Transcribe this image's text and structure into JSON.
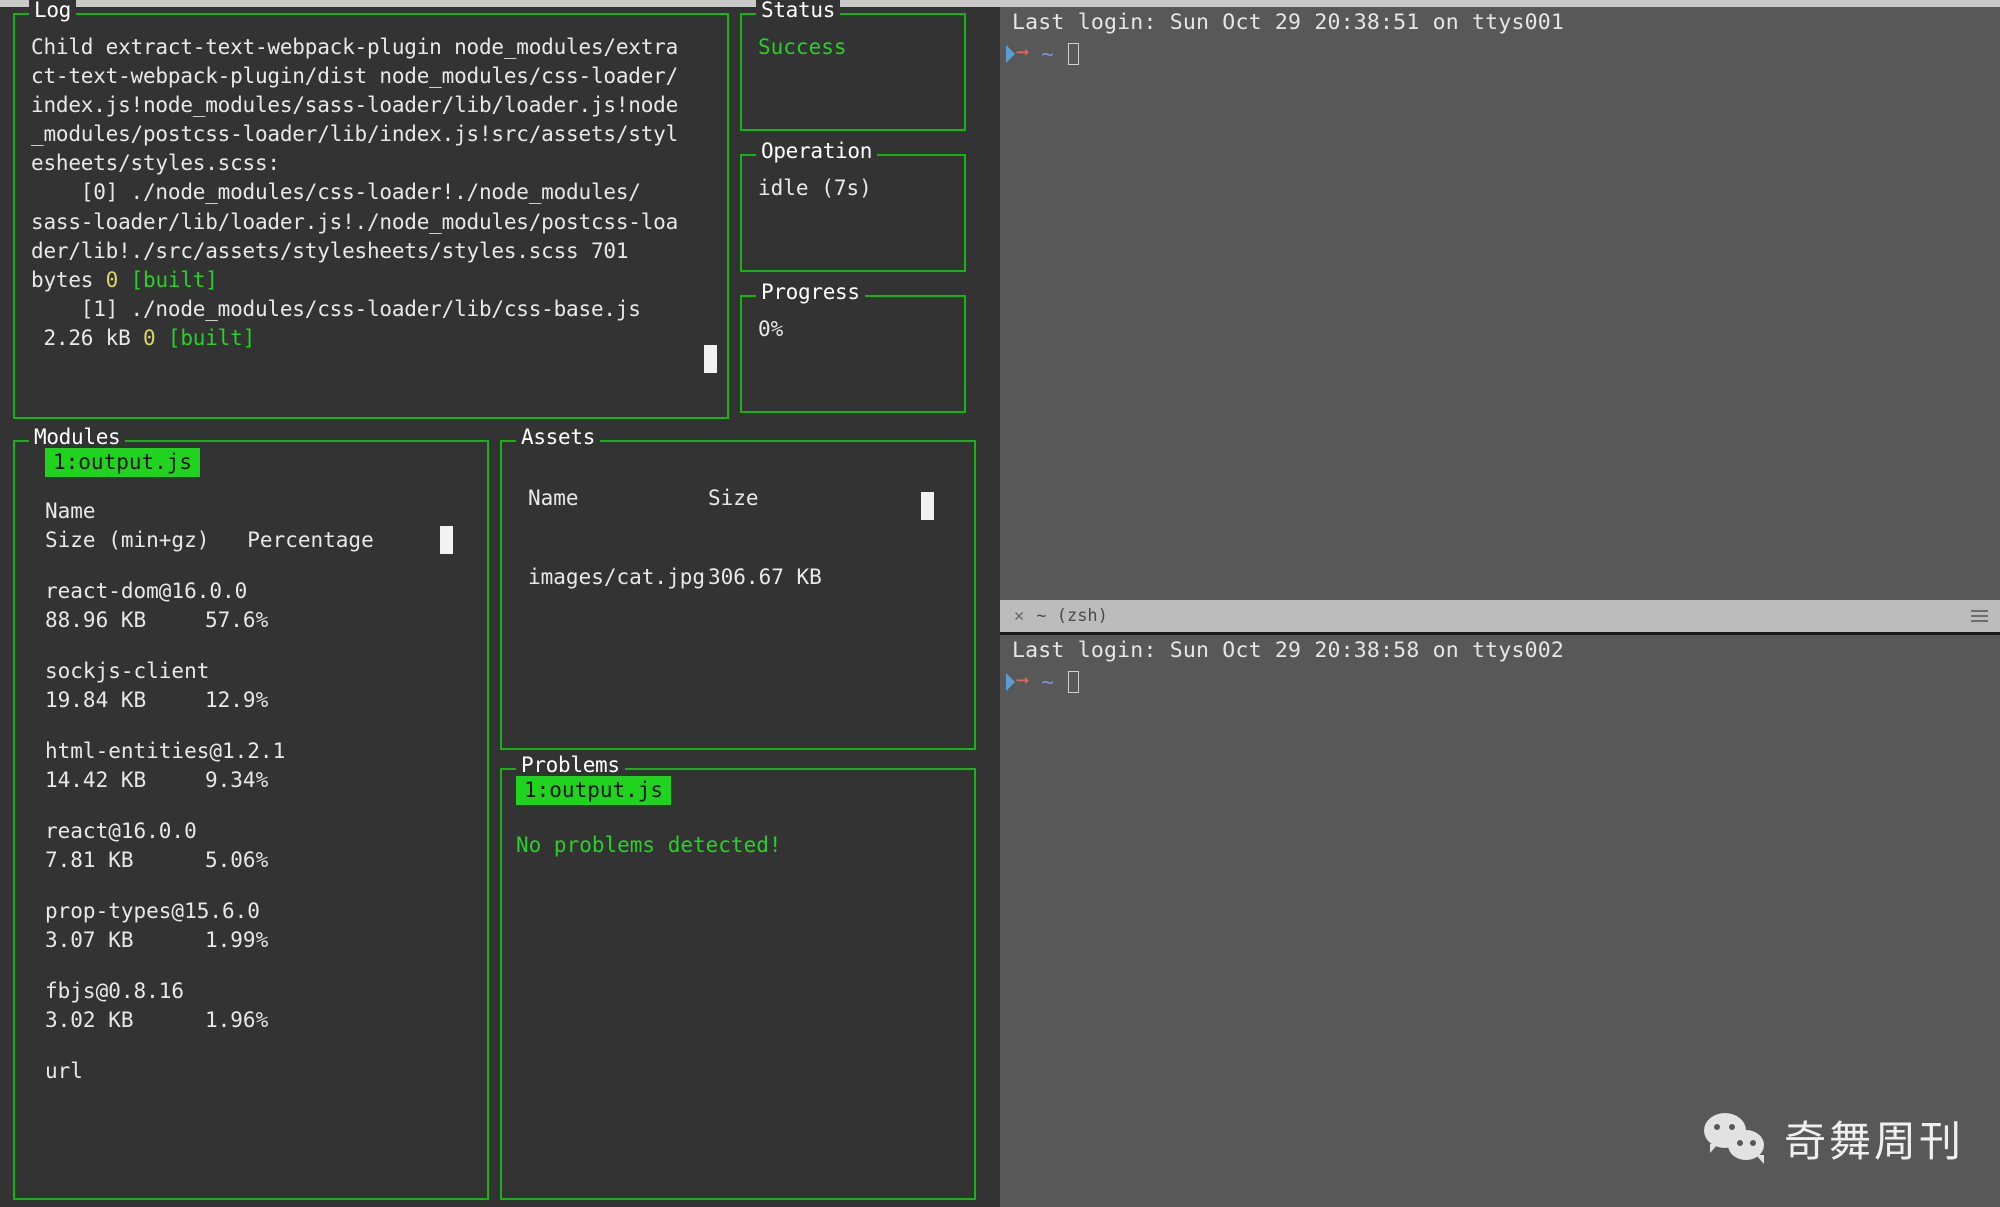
{
  "dashboard": {
    "log": {
      "title": "Log",
      "lines": [
        [
          {
            "t": "Child extract-text-webpack-plugin node_modules/extra",
            "c": "plain"
          }
        ],
        [
          {
            "t": "ct-text-webpack-plugin/dist node_modules/css-loader/",
            "c": "plain"
          }
        ],
        [
          {
            "t": "index.js!node_modules/sass-loader/lib/loader.js!node",
            "c": "plain"
          }
        ],
        [
          {
            "t": "_modules/postcss-loader/lib/index.js!src/assets/styl",
            "c": "plain"
          }
        ],
        [
          {
            "t": "esheets/styles.scss:",
            "c": "plain"
          }
        ],
        [
          {
            "t": "    [0] ./node_modules/css-loader!./node_modules/",
            "c": "plain"
          }
        ],
        [
          {
            "t": "sass-loader/lib/loader.js!./node_modules/postcss-loa",
            "c": "plain"
          }
        ],
        [
          {
            "t": "der/lib!./src/assets/stylesheets/styles.scss 701",
            "c": "plain"
          }
        ],
        [
          {
            "t": "bytes ",
            "c": "plain"
          },
          {
            "t": "0",
            "c": "yellow"
          },
          {
            "t": " ",
            "c": "plain"
          },
          {
            "t": "[built]",
            "c": "green"
          }
        ],
        [
          {
            "t": "    [1] ./node_modules/css-loader/lib/css-base.js",
            "c": "plain"
          }
        ],
        [
          {
            "t": " 2.26 kB ",
            "c": "plain"
          },
          {
            "t": "0",
            "c": "yellow"
          },
          {
            "t": " ",
            "c": "plain"
          },
          {
            "t": "[built]",
            "c": "green"
          }
        ]
      ]
    },
    "status": {
      "title": "Status",
      "value": "Success"
    },
    "operation": {
      "title": "Operation",
      "value": "idle (7s)"
    },
    "progress": {
      "title": "Progress",
      "value": "0%"
    },
    "modules": {
      "title": "Modules",
      "tab": "1:output.js",
      "header_name": "Name",
      "header_cols": "Size (min+gz)   Percentage",
      "rows": [
        {
          "name": "react-dom@16.0.0",
          "size": "88.96 KB",
          "percentage": "57.6%"
        },
        {
          "name": "sockjs-client",
          "size": "19.84 KB",
          "percentage": "12.9%"
        },
        {
          "name": "html-entities@1.2.1",
          "size": "14.42 KB",
          "percentage": "9.34%"
        },
        {
          "name": "react@16.0.0",
          "size": "7.81 KB",
          "percentage": "5.06%"
        },
        {
          "name": "prop-types@15.6.0",
          "size": "3.07 KB",
          "percentage": "1.99%"
        },
        {
          "name": "fbjs@0.8.16",
          "size": "3.02 KB",
          "percentage": "1.96%"
        },
        {
          "name": "url",
          "size": "",
          "percentage": ""
        }
      ]
    },
    "assets": {
      "title": "Assets",
      "header_name": "Name",
      "header_size": "Size",
      "rows": [
        {
          "name": "images/cat.jpg",
          "size": "306.67 KB"
        }
      ]
    },
    "problems": {
      "title": "Problems",
      "tab": "1:output.js",
      "message": "No problems detected!"
    }
  },
  "terminal": {
    "pane1": {
      "last_login": "Last login: Sun Oct 29 20:38:51 on ttys001",
      "prompt_path": "~"
    },
    "divider": {
      "close_glyph": "✕",
      "title": "~ (zsh)"
    },
    "pane2": {
      "last_login": "Last login: Sun Oct 29 20:38:58 on ttys002",
      "prompt_path": "~"
    }
  },
  "watermark": {
    "text": "奇舞周刊"
  },
  "colors": {
    "border_green": "#12b512",
    "accent_green": "#27d127",
    "chip_green": "#1fd31f",
    "panel_bg": "#333333",
    "terminal_bg": "#585858"
  }
}
